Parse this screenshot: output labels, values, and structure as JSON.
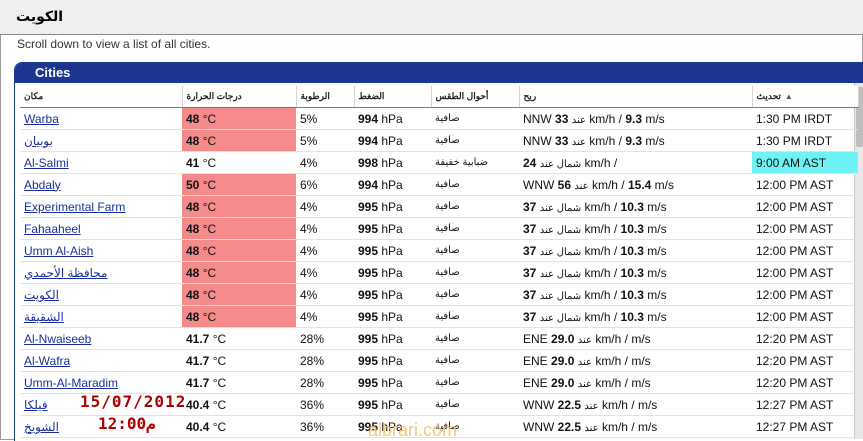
{
  "page": {
    "title": "الكويت",
    "instruction": "Scroll down to view a list of all cities."
  },
  "panel": {
    "title": "Cities"
  },
  "columns": {
    "city": "مكان",
    "temp": "درجات الحرارة",
    "humidity": "الرطوبة",
    "pressure": "الضغط",
    "conditions": "أحوال الطقس",
    "wind": "ريح",
    "updated": "تحديث"
  },
  "rows": [
    {
      "city": "Warba",
      "temp": "48",
      "temp_unit": "°C",
      "hot": true,
      "humidity": "5%",
      "pressure": "994",
      "p_unit": "hPa",
      "conditions": "صافية",
      "wind_dir": "NNW",
      "wind_kmh": "33",
      "wind_mid": "عند",
      "wind_unit1": "km/h /",
      "wind_ms": "9.3",
      "wind_unit2": "m/s",
      "updated": "1:30 PM IRDT",
      "hl": false
    },
    {
      "city": "بوبيان",
      "temp": "48",
      "temp_unit": "°C",
      "hot": true,
      "humidity": "5%",
      "pressure": "994",
      "p_unit": "hPa",
      "conditions": "صافية",
      "wind_dir": "NNW",
      "wind_kmh": "33",
      "wind_mid": "عند",
      "wind_unit1": "km/h /",
      "wind_ms": "9.3",
      "wind_unit2": "m/s",
      "updated": "1:30 PM IRDT",
      "hl": false
    },
    {
      "city": "Al-Salmi",
      "temp": "41",
      "temp_unit": "°C",
      "hot": false,
      "humidity": "4%",
      "pressure": "998",
      "p_unit": "hPa",
      "conditions": "ضبابية خفيفة",
      "wind_dir": "",
      "wind_kmh": "24",
      "wind_mid": "شمال عند",
      "wind_unit1": "km/h /",
      "wind_ms": "",
      "wind_unit2": "",
      "updated": "9:00 AM AST",
      "hl": true
    },
    {
      "city": "Abdaly",
      "temp": "50",
      "temp_unit": "°C",
      "hot": true,
      "humidity": "6%",
      "pressure": "994",
      "p_unit": "hPa",
      "conditions": "صافية",
      "wind_dir": "WNW",
      "wind_kmh": "56",
      "wind_mid": "عند",
      "wind_unit1": "km/h /",
      "wind_ms": "15.4",
      "wind_unit2": "m/s",
      "updated": "12:00 PM AST",
      "hl": false
    },
    {
      "city": "Experimental Farm",
      "temp": "48",
      "temp_unit": "°C",
      "hot": true,
      "humidity": "4%",
      "pressure": "995",
      "p_unit": "hPa",
      "conditions": "صافية",
      "wind_dir": "",
      "wind_kmh": "37",
      "wind_mid": "شمال عند",
      "wind_unit1": "km/h /",
      "wind_ms": "10.3",
      "wind_unit2": "m/s",
      "updated": "12:00 PM AST",
      "hl": false
    },
    {
      "city": "Fahaaheel",
      "temp": "48",
      "temp_unit": "°C",
      "hot": true,
      "humidity": "4%",
      "pressure": "995",
      "p_unit": "hPa",
      "conditions": "صافية",
      "wind_dir": "",
      "wind_kmh": "37",
      "wind_mid": "شمال عند",
      "wind_unit1": "km/h /",
      "wind_ms": "10.3",
      "wind_unit2": "m/s",
      "updated": "12:00 PM AST",
      "hl": false
    },
    {
      "city": "Umm Al-Aish",
      "temp": "48",
      "temp_unit": "°C",
      "hot": true,
      "humidity": "4%",
      "pressure": "995",
      "p_unit": "hPa",
      "conditions": "صافية",
      "wind_dir": "",
      "wind_kmh": "37",
      "wind_mid": "شمال عند",
      "wind_unit1": "km/h /",
      "wind_ms": "10.3",
      "wind_unit2": "m/s",
      "updated": "12:00 PM AST",
      "hl": false
    },
    {
      "city": "محافظة الأحمدي",
      "temp": "48",
      "temp_unit": "°C",
      "hot": true,
      "humidity": "4%",
      "pressure": "995",
      "p_unit": "hPa",
      "conditions": "صافية",
      "wind_dir": "",
      "wind_kmh": "37",
      "wind_mid": "شمال عند",
      "wind_unit1": "km/h /",
      "wind_ms": "10.3",
      "wind_unit2": "m/s",
      "updated": "12:00 PM AST",
      "hl": false
    },
    {
      "city": "الكويت",
      "temp": "48",
      "temp_unit": "°C",
      "hot": true,
      "humidity": "4%",
      "pressure": "995",
      "p_unit": "hPa",
      "conditions": "صافية",
      "wind_dir": "",
      "wind_kmh": "37",
      "wind_mid": "شمال عند",
      "wind_unit1": "km/h /",
      "wind_ms": "10.3",
      "wind_unit2": "m/s",
      "updated": "12:00 PM AST",
      "hl": false
    },
    {
      "city": "الشقيقة",
      "temp": "48",
      "temp_unit": "°C",
      "hot": true,
      "humidity": "4%",
      "pressure": "995",
      "p_unit": "hPa",
      "conditions": "صافية",
      "wind_dir": "",
      "wind_kmh": "37",
      "wind_mid": "شمال عند",
      "wind_unit1": "km/h /",
      "wind_ms": "10.3",
      "wind_unit2": "m/s",
      "updated": "12:00 PM AST",
      "hl": false
    },
    {
      "city": "Al-Nwaiseeb",
      "temp": "41.7",
      "temp_unit": "°C",
      "hot": false,
      "humidity": "28%",
      "pressure": "995",
      "p_unit": "hPa",
      "conditions": "صافية",
      "wind_dir": "ENE",
      "wind_kmh": "29.0",
      "wind_mid": "عند",
      "wind_unit1": "km/h /",
      "wind_ms": "",
      "wind_unit2": "m/s",
      "updated": "12:20 PM AST",
      "hl": false
    },
    {
      "city": "Al-Wafra",
      "temp": "41.7",
      "temp_unit": "°C",
      "hot": false,
      "humidity": "28%",
      "pressure": "995",
      "p_unit": "hPa",
      "conditions": "صافية",
      "wind_dir": "ENE",
      "wind_kmh": "29.0",
      "wind_mid": "عند",
      "wind_unit1": "km/h /",
      "wind_ms": "",
      "wind_unit2": "m/s",
      "updated": "12:20 PM AST",
      "hl": false
    },
    {
      "city": "Umm-Al-Maradim",
      "temp": "41.7",
      "temp_unit": "°C",
      "hot": false,
      "humidity": "28%",
      "pressure": "995",
      "p_unit": "hPa",
      "conditions": "صافية",
      "wind_dir": "ENE",
      "wind_kmh": "29.0",
      "wind_mid": "عند",
      "wind_unit1": "km/h /",
      "wind_ms": "",
      "wind_unit2": "m/s",
      "updated": "12:20 PM AST",
      "hl": false
    },
    {
      "city": "فيلكا",
      "temp": "40.4",
      "temp_unit": "°C",
      "hot": false,
      "humidity": "36%",
      "pressure": "995",
      "p_unit": "hPa",
      "conditions": "صافية",
      "wind_dir": "WNW",
      "wind_kmh": "22.5",
      "wind_mid": "عند",
      "wind_unit1": "km/h /",
      "wind_ms": "",
      "wind_unit2": "m/s",
      "updated": "12:27 PM AST",
      "hl": false
    },
    {
      "city": "الشويخ",
      "temp": "40.4",
      "temp_unit": "°C",
      "hot": false,
      "humidity": "36%",
      "pressure": "995",
      "p_unit": "hPa",
      "conditions": "صافية",
      "wind_dir": "WNW",
      "wind_kmh": "22.5",
      "wind_mid": "عند",
      "wind_unit1": "km/h /",
      "wind_ms": "",
      "wind_unit2": "m/s",
      "updated": "12:27 PM AST",
      "hl": false
    }
  ],
  "overlay": {
    "date": "15/07/2012",
    "time": "12:00م",
    "watermark": "albrari.com"
  },
  "colors": {
    "header_blue": "#1a368f",
    "hot_cell": "#f58a8a",
    "highlight_cell": "#6ff2f5",
    "link": "#1a2f9f",
    "overlay_red": "#b00000"
  }
}
